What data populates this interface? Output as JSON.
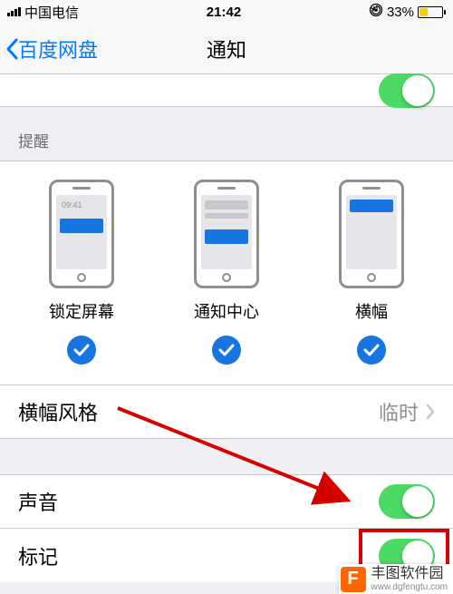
{
  "status": {
    "carrier": "中国电信",
    "time": "21:42",
    "battery_pct": "33%",
    "lock_icon": "lock"
  },
  "nav": {
    "back_label": "百度网盘",
    "title": "通知"
  },
  "allow_toggle": true,
  "section_header_alerts": "提醒",
  "styles": {
    "lock": {
      "label": "锁定屏幕",
      "clock": "09:41",
      "checked": true
    },
    "nc": {
      "label": "通知中心",
      "checked": true
    },
    "banner": {
      "label": "横幅",
      "checked": true
    }
  },
  "banner_style_row": {
    "label": "横幅风格",
    "value": "临时"
  },
  "sound_row": {
    "label": "声音",
    "on": true
  },
  "badge_row": {
    "label": "标记",
    "on": true
  },
  "watermark": {
    "brand": "丰图软件园",
    "url": "www.dgfengtu.com",
    "logo_letter": "F"
  }
}
